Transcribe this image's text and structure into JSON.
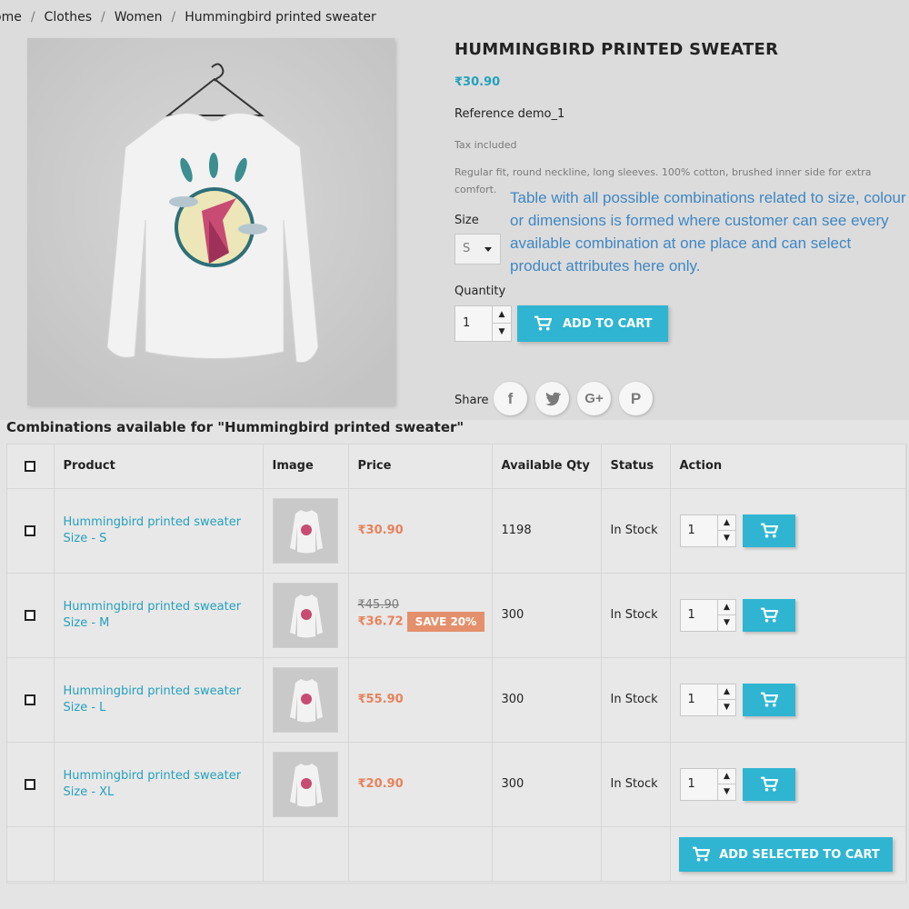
{
  "breadcrumb": [
    "ome",
    "Clothes",
    "Women",
    "Hummingbird printed sweater"
  ],
  "product": {
    "title": "HUMMINGBIRD PRINTED SWEATER",
    "price": "₹30.90",
    "reference_label": "Reference",
    "reference_value": "demo_1",
    "tax": "Tax included",
    "description": "Regular fit, round neckline, long sleeves. 100% cotton, brushed inner side for extra comfort.",
    "size_label": "Size",
    "size_value": "S",
    "quantity_label": "Quantity",
    "quantity_value": "1",
    "add_to_cart": "ADD TO CART",
    "share_label": "Share"
  },
  "annotation": "Table with all possible combinations related to size, colour or dimensions is formed where customer can see every available combination at one place and can select product attributes here only.",
  "combinations": {
    "title": "Combinations available for \"Hummingbird printed sweater\"",
    "headers": {
      "product": "Product",
      "image": "Image",
      "price": "Price",
      "qty": "Available Qty",
      "status": "Status",
      "action": "Action"
    },
    "rows": [
      {
        "name": "Hummingbird printed sweater",
        "size": "Size - S",
        "price": "₹30.90",
        "qty": "1198",
        "status": "In Stock",
        "quantity": "1"
      },
      {
        "name": "Hummingbird printed sweater",
        "size": "Size - M",
        "old_price": "₹45.90",
        "price": "₹36.72",
        "save": "SAVE 20%",
        "qty": "300",
        "status": "In Stock",
        "quantity": "1"
      },
      {
        "name": "Hummingbird printed sweater",
        "size": "Size - L",
        "price": "₹55.90",
        "qty": "300",
        "status": "In Stock",
        "quantity": "1"
      },
      {
        "name": "Hummingbird printed sweater",
        "size": "Size - XL",
        "price": "₹20.90",
        "qty": "300",
        "status": "In Stock",
        "quantity": "1"
      }
    ],
    "add_selected": "ADD SELECTED TO CART"
  },
  "colors": {
    "accent": "#2fb5d2",
    "price_orange": "#e8825a",
    "annotation_blue": "#3f87c4"
  }
}
